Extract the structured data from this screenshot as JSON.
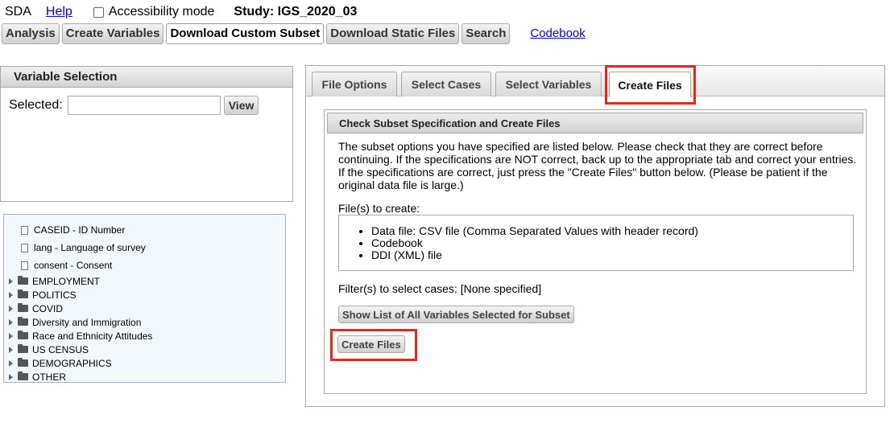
{
  "top": {
    "sda": "SDA",
    "help": "Help",
    "accessibility": "Accessibility mode",
    "study": "Study: IGS_2020_03"
  },
  "nav": {
    "analysis": "Analysis",
    "create_variables": "Create Variables",
    "download_custom_subset": "Download Custom Subset",
    "download_static_files": "Download Static Files",
    "search": "Search",
    "codebook": "Codebook"
  },
  "variable_selection": {
    "title": "Variable Selection",
    "selected_label": "Selected:",
    "selected_value": "",
    "view_button": "View"
  },
  "tree": {
    "leaves": [
      "CASEID - ID Number",
      "lang - Language of survey",
      "consent - Consent"
    ],
    "folders": [
      "EMPLOYMENT",
      "POLITICS",
      "COVID",
      "Diversity and Immigration",
      "Race and Ethnicity Attitudes",
      "US CENSUS",
      "DEMOGRAPHICS",
      "OTHER"
    ]
  },
  "tabs": {
    "file_options": "File Options",
    "select_cases": "Select Cases",
    "select_variables": "Select Variables",
    "create_files": "Create Files"
  },
  "content": {
    "header": "Check Subset Specification and Create Files",
    "description": "The subset options you have specified are listed below. Please check that they are correct before continuing. If the specifications are NOT correct, back up to the appropriate tab and correct your entries. If the specifications are correct, just press the \"Create Files\" button below. (Please be patient if the original data file is large.)",
    "files_to_create_label": "File(s) to create:",
    "files": [
      "Data file: CSV file (Comma Separated Values with header record)",
      "Codebook",
      "DDI (XML) file"
    ],
    "filter": "Filter(s) to select cases: [None specified]",
    "show_list_button": "Show List of All Variables Selected for Subset",
    "create_files_button": "Create Files"
  },
  "colors": {
    "highlight": "#e8261a",
    "link": "#0000ee"
  }
}
